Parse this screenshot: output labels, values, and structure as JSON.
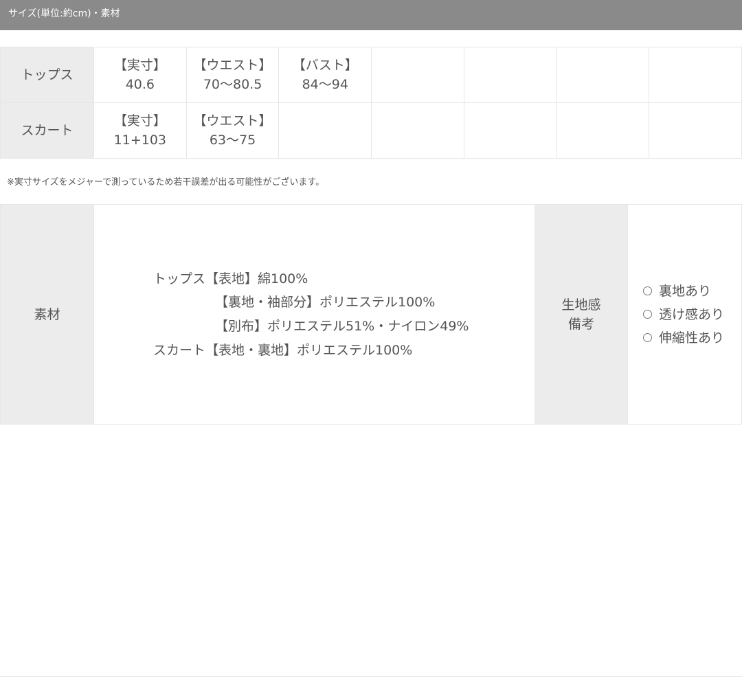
{
  "header": {
    "title": "サイズ(単位:約cm)・素材"
  },
  "size_table": {
    "rows": [
      {
        "label": "トップス",
        "cells": [
          {
            "head": "【実寸】",
            "value": "40.6"
          },
          {
            "head": "【ウエスト】",
            "value": "70〜80.5"
          },
          {
            "head": "【バスト】",
            "value": "84〜94"
          }
        ]
      },
      {
        "label": "スカート",
        "cells": [
          {
            "head": "【実寸】",
            "value": "11+103"
          },
          {
            "head": "【ウエスト】",
            "value": "63〜75"
          }
        ]
      }
    ]
  },
  "note": "※実寸サイズをメジャーで測っているため若干誤差が出る可能性がございます。",
  "material": {
    "label": "素材",
    "lines": [
      "トップス【表地】綿100%",
      "【裏地・袖部分】ポリエステル100%",
      "【別布】ポリエステル51%・ナイロン49%",
      "スカート【表地・裏地】ポリエステル100%"
    ],
    "feel_label_1": "生地感",
    "feel_label_2": "備考",
    "feel_items": [
      "裏地あり",
      "透け感あり",
      "伸縮性あり"
    ]
  }
}
